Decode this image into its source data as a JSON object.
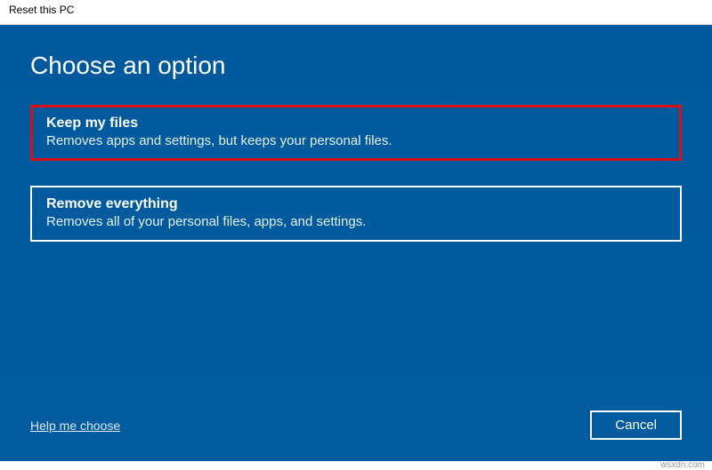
{
  "window": {
    "title": "Reset this PC"
  },
  "heading": "Choose an option",
  "options": [
    {
      "title": "Keep my files",
      "description": "Removes apps and settings, but keeps your personal files.",
      "highlighted": true
    },
    {
      "title": "Remove everything",
      "description": "Removes all of your personal files, apps, and settings.",
      "highlighted": false
    }
  ],
  "footer": {
    "help_link": "Help me choose",
    "cancel_label": "Cancel"
  },
  "watermark": "wsxdn.com"
}
